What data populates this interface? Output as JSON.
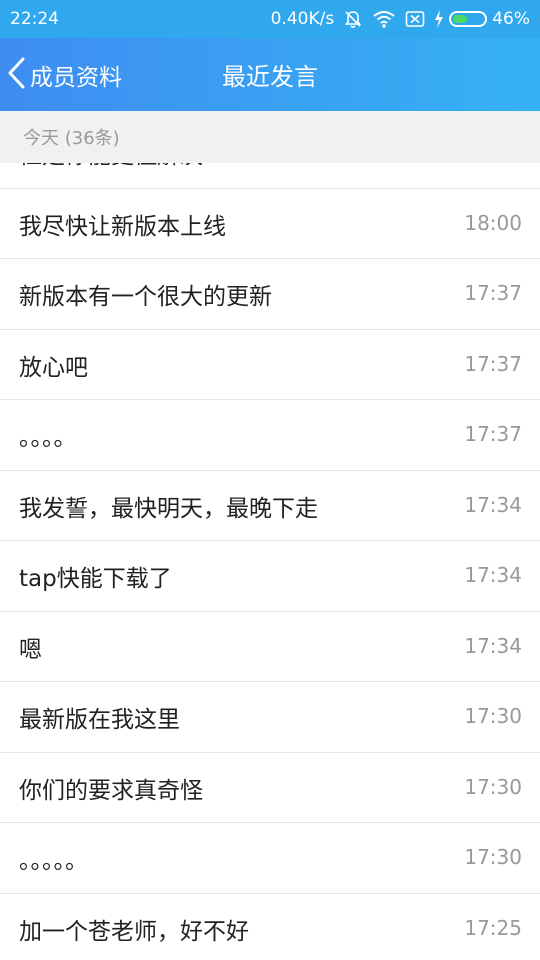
{
  "status_bar": {
    "time": "22:24",
    "net_speed": "0.40K/s",
    "battery_percent": "46%",
    "battery_level": 0.46,
    "icons": [
      "bell-off-icon",
      "wifi-icon",
      "sim-off-icon",
      "charging-icon",
      "battery-icon"
    ]
  },
  "nav": {
    "back_label": "成员资料",
    "title": "最近发言"
  },
  "section": {
    "header": "今天 (36条)"
  },
  "messages": [
    {
      "text": "恒是你能更但解决",
      "time": ""
    },
    {
      "text": "我尽快让新版本上线",
      "time": "18:00"
    },
    {
      "text": "新版本有一个很大的更新",
      "time": "17:37"
    },
    {
      "text": "放心吧",
      "time": "17:37"
    },
    {
      "text": "。。。。",
      "time": "17:37"
    },
    {
      "text": "我发誓，最快明天，最晚下走",
      "time": "17:34"
    },
    {
      "text": "tap快能下载了",
      "time": "17:34"
    },
    {
      "text": "嗯",
      "time": "17:34"
    },
    {
      "text": "最新版在我这里",
      "time": "17:30"
    },
    {
      "text": "你们的要求真奇怪",
      "time": "17:30"
    },
    {
      "text": "。。。。。",
      "time": "17:30"
    },
    {
      "text": "加一个苍老师，好不好",
      "time": "17:25"
    }
  ],
  "colors": {
    "status_bg": "#2fa8ee",
    "nav_gradient_start": "#3e8df1",
    "nav_gradient_end": "#35b2f4",
    "battery_fill": "#4cd964"
  }
}
